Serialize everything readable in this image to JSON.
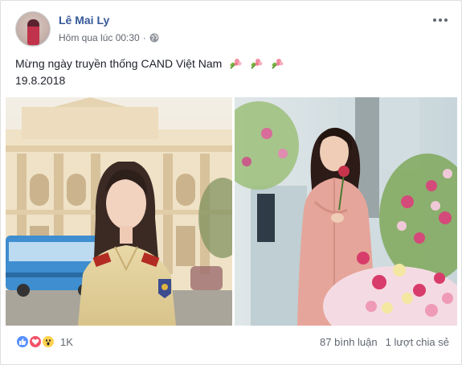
{
  "post": {
    "author": "Lê Mai Ly",
    "timestamp": "Hôm qua lúc 00:30",
    "privacy_icon": "globe-icon",
    "text_line1": "Mừng ngày truyền thống CAND Việt Nam",
    "text_line2": "19.8.2018",
    "emoji": [
      "rose-bouquet-icon",
      "rose-bouquet-icon",
      "rose-bouquet-icon"
    ]
  },
  "photos": [
    {
      "name": "photo-woman-police-uniform"
    },
    {
      "name": "photo-woman-pink-dress-flowers"
    }
  ],
  "reactions": {
    "icons": [
      "like-icon",
      "love-icon",
      "wow-icon"
    ],
    "count": "1K",
    "comments": "87 bình luận",
    "shares": "1 lượt chia sẻ"
  },
  "colors": {
    "link": "#365899",
    "meta": "#616770",
    "like": "#5890ff",
    "love": "#f25268",
    "wow": "#fed24f"
  }
}
